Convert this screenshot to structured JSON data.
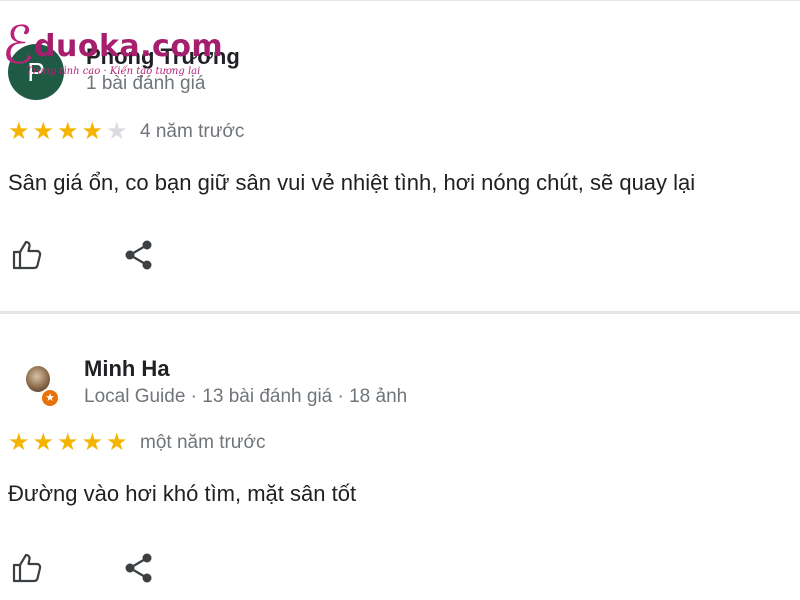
{
  "watermark": {
    "brand": "duoka.com",
    "tagline": "Trang tình cao · Kiến tạo tương lai"
  },
  "reviews": [
    {
      "avatar_letter": "P",
      "name": "Phong Trương",
      "meta": "1 bài đánh giá",
      "rating": 4,
      "max_rating": 5,
      "time": "4 năm trước",
      "text": "Sân giá ổn, co bạn giữ sân vui vẻ nhiệt tình, hơi nóng chút, sẽ quay lại",
      "actions": {
        "like_icon": "thumbs-up-icon",
        "share_icon": "share-icon"
      }
    },
    {
      "avatar_letter": "",
      "badge_icon": "local-guide-star-icon",
      "name": "Minh Ha",
      "meta": "Local Guide · 13 bài đánh giá · 18 ảnh",
      "rating": 5,
      "max_rating": 5,
      "time": "một năm trước",
      "text": "Đường vào hơi khó tìm, mặt sân tốt",
      "actions": {
        "like_icon": "thumbs-up-icon",
        "share_icon": "share-icon"
      }
    }
  ],
  "colors": {
    "star_on": "#f5b400",
    "star_off": "#dadce0",
    "avatar_bg": "#1f5a44",
    "badge": "#e8710a",
    "watermark": "#a51f6e"
  }
}
